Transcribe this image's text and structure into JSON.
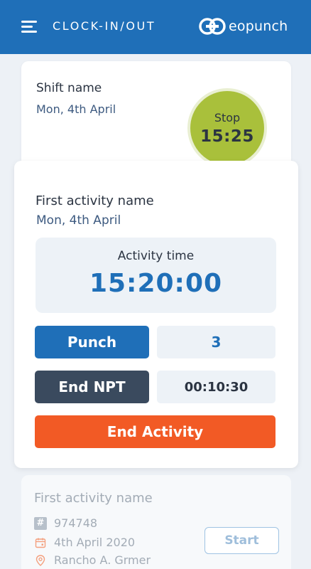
{
  "header": {
    "title": "CLOCK-IN/OUT",
    "logo_text": "eopunch"
  },
  "shift": {
    "name": "Shift name",
    "date": "Mon, 4th April",
    "stop_label": "Stop",
    "stop_time": "15:25"
  },
  "activity": {
    "name": "First activity name",
    "date": "Mon, 4th April",
    "time_label": "Activity time",
    "time_value": "15:20:00",
    "punch_label": "Punch",
    "punch_count": "3",
    "npt_label": "End NPT",
    "npt_time": "00:10:30",
    "end_label": "End Activity"
  },
  "next_activity": {
    "name": "First activity name",
    "id": "974748",
    "date": "4th April 2020",
    "location": "Rancho A. Grmer",
    "start_label": "Start"
  },
  "colors": {
    "header": "#1f6fb8",
    "stop": "#a9c03b",
    "punch": "#1f6fb8",
    "npt": "#3a4a5e",
    "end_activity": "#f25a25"
  }
}
